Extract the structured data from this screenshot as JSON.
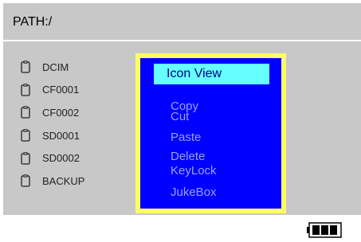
{
  "path_bar": {
    "label": "PATH:/"
  },
  "files": [
    {
      "name": "DCIM",
      "icon": "file-icon"
    },
    {
      "name": "CF0001",
      "icon": "file-icon"
    },
    {
      "name": "CF0002",
      "icon": "file-icon"
    },
    {
      "name": "SD0001",
      "icon": "file-icon"
    },
    {
      "name": "SD0002",
      "icon": "file-icon"
    },
    {
      "name": "BACKUP",
      "icon": "file-icon"
    }
  ],
  "context_menu": {
    "selected": "Icon View",
    "items": [
      "Icon View",
      "Copy",
      "Cut",
      "Paste",
      "Delete",
      "KeyLock",
      "JukeBox"
    ]
  },
  "status": {
    "battery_icon": "battery-full-icon",
    "battery_level": 3,
    "battery_max": 3
  },
  "colors": {
    "screen_bg": "#c8c8c8",
    "menu_border": "#ffff66",
    "menu_bg": "#0000ff",
    "menu_text": "#9aa0ff",
    "highlight_bg": "#66ffff",
    "highlight_text": "#000080"
  }
}
